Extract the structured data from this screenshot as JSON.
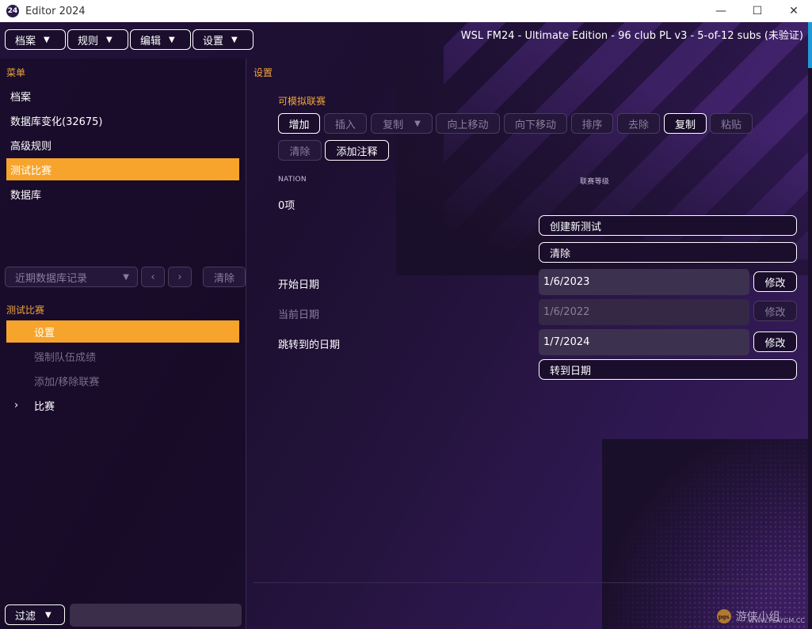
{
  "window": {
    "app_icon_text": "24",
    "title": "Editor 2024",
    "minimize": "—",
    "maximize": "☐",
    "close": "✕"
  },
  "caption": "WSL FM24 - Ultimate Edition - 96 club PL v3 - 5-of-12 subs (未验证)",
  "menu": [
    {
      "label": "档案"
    },
    {
      "label": "规则"
    },
    {
      "label": "编辑"
    },
    {
      "label": "设置"
    }
  ],
  "left": {
    "menu_title": "菜单",
    "items": [
      {
        "label": "档案"
      },
      {
        "label": "数据库变化(32675)"
      },
      {
        "label": "高级规则"
      },
      {
        "label": "测试比赛"
      },
      {
        "label": "数据库"
      }
    ],
    "history_placeholder": "近期数据库记录",
    "history_clear": "清除",
    "section_title": "测试比赛",
    "sub_items": [
      {
        "label": "设置"
      },
      {
        "label": "强制队伍成绩"
      },
      {
        "label": "添加/移除联赛"
      },
      {
        "label": "比赛"
      }
    ],
    "filter_label": "过滤"
  },
  "right": {
    "title": "设置",
    "subtitle": "可模拟联赛",
    "toolbar": {
      "add": "增加",
      "insert": "插入",
      "copy_dropdown": "复制",
      "move_up": "向上移动",
      "move_down": "向下移动",
      "sort": "排序",
      "remove": "去除",
      "copy": "复制",
      "paste": "粘贴",
      "clear": "清除",
      "add_note": "添加注释"
    },
    "columns": {
      "nation": "NATION",
      "league_level": "联赛等级"
    },
    "count": "0项",
    "create_test": "创建新测试",
    "clear": "清除",
    "start_date_label": "开始日期",
    "start_date": "1/6/2023",
    "current_date_label": "当前日期",
    "current_date": "1/6/2022",
    "jump_date_label": "跳转到的日期",
    "jump_date": "1/7/2024",
    "modify": "修改",
    "goto_date": "转到日期"
  },
  "watermark": {
    "logo_text": "pgs",
    "text": "游侠小组",
    "site": "WWW.PLAYGM.CC"
  },
  "colors": {
    "accent": "#f7a42c",
    "heading": "#f2a53a",
    "background": "#1a0f2a"
  }
}
